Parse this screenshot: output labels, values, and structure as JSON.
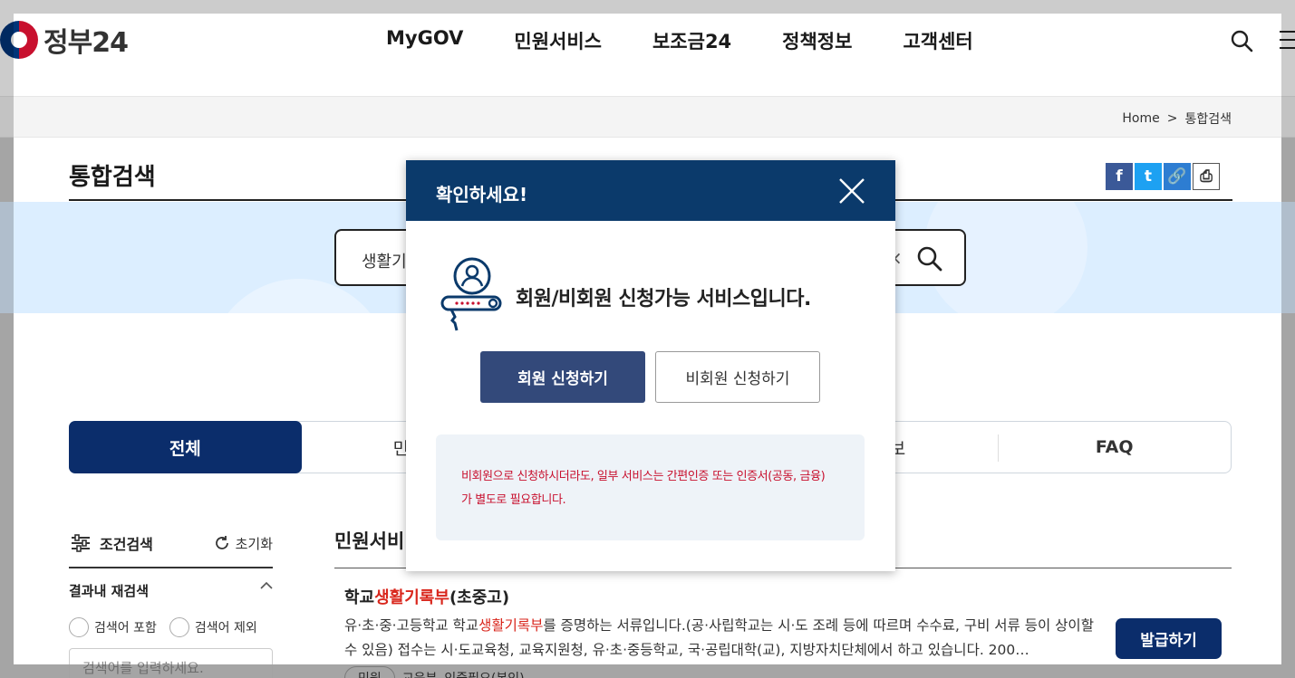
{
  "header": {
    "logo_text": "정부24",
    "nav": [
      "MyGOV",
      "민원서비스",
      "보조금24",
      "정책정보",
      "고객센터"
    ]
  },
  "breadcrumb": {
    "home": "Home",
    "sep": ">",
    "current": "통합검색"
  },
  "page": {
    "title": "통합검색"
  },
  "share": {
    "facebook": "f",
    "twitter": "t",
    "link": "🔗",
    "print": "⎙"
  },
  "search": {
    "value": "생활기",
    "clear": "×"
  },
  "tabs": [
    "전체",
    "민원서",
    "",
    "관정보",
    "FAQ"
  ],
  "filter": {
    "title": "조건검색",
    "reset": "초기화",
    "refine_title": "결과내 재검색",
    "include": "검색어 포함",
    "exclude": "검색어 제외",
    "placeholder": "검색어를 입력하세요."
  },
  "results": {
    "section": "민원서비",
    "item": {
      "title_pre": "학교",
      "title_hl": "생활기록부",
      "title_post": "(초중고)",
      "desc_1": "유·초·중·고등학교 학교",
      "desc_hl": "생활기록부",
      "desc_2": "를 증명하는 서류입니다.(공·사립학교는 시·도 조례 등에 따르며 수수료, 구비 서류 등이 상이할 수 있음) 접수는 시·도교육청, 교육지원청, 유·초·중등학교, 국·공립대학(교), 지방자치단체에서 하고 있습니다. 200…",
      "button": "발급하기",
      "tag_1": "민원",
      "tag_2": "교육부",
      "tag_3": "인증필요(본인)"
    }
  },
  "modal": {
    "title": "확인하세요!",
    "message": "회원/비회원 신청가능 서비스입니다.",
    "member_button": "회원 신청하기",
    "guest_button": "비회원 신청하기",
    "notice_line_1": "비회원으로 신청하시더라도, 일부 서비스는 간편인증 또는 인증서(공동, 금융)",
    "notice_line_2": "가 별도로 필요합니다."
  },
  "colors": {
    "primary": "#0b2d6b",
    "modal_header": "#0b3a6b",
    "highlight": "#d9261c",
    "notice_text": "#c8102e"
  }
}
